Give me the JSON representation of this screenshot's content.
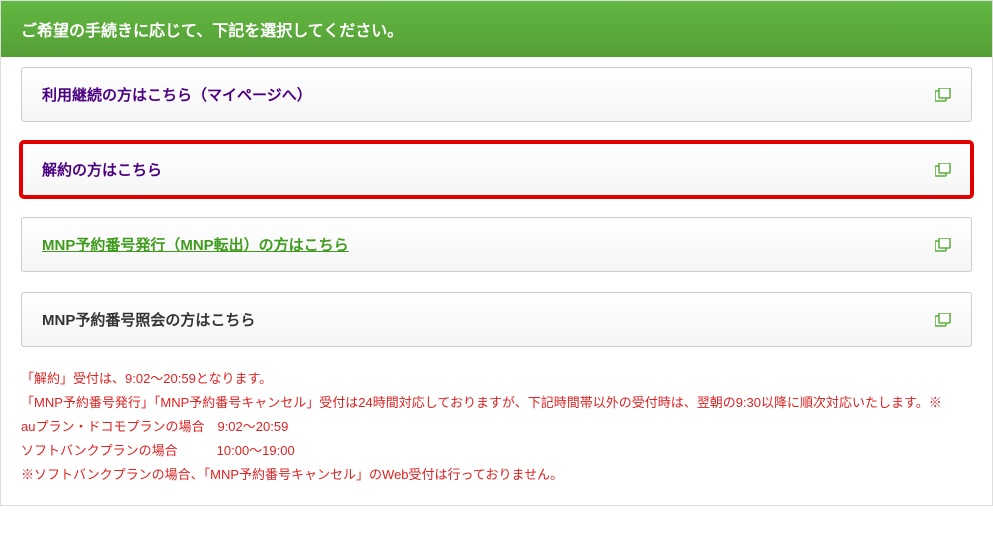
{
  "header": {
    "title": "ご希望の手続きに応じて、下記を選択してください。"
  },
  "options": [
    {
      "label": "利用継続の方はこちら（マイページへ）",
      "style": "purple",
      "highlighted": false
    },
    {
      "label": "解約の方はこちら",
      "style": "purple",
      "highlighted": true
    },
    {
      "label": "MNP予約番号発行（MNP転出）の方はこちら",
      "style": "green",
      "highlighted": false
    },
    {
      "label": "MNP予約番号照会の方はこちら",
      "style": "black",
      "highlighted": false
    }
  ],
  "notes": {
    "line1": "「解約」受付は、9:02～20:59となります。",
    "line2": "「MNP予約番号発行」「MNP予約番号キャンセル」受付は24時間対応しておりますが、下記時間帯以外の受付時は、翌朝の9:30以降に順次対応いたします。※",
    "line3": "auプラン・ドコモプランの場合　9:02～20:59",
    "line4": "ソフトバンクプランの場合　　　10:00～19:00",
    "line5": "※ソフトバンクプランの場合、「MNP予約番号キャンセル」のWeb受付は行っておりません。"
  }
}
